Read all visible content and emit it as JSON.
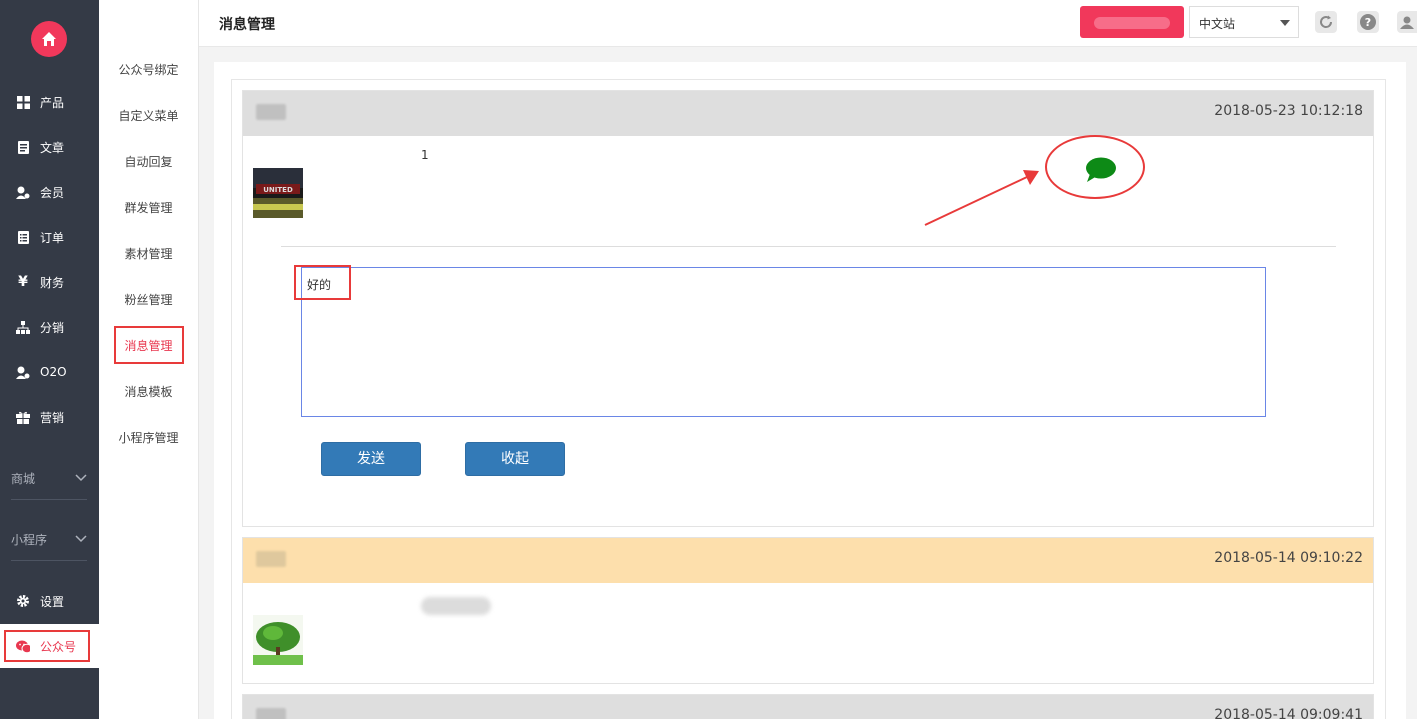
{
  "nav": {
    "items": [
      {
        "label": "产品",
        "icon": "grid-icon"
      },
      {
        "label": "文章",
        "icon": "document-icon"
      },
      {
        "label": "会员",
        "icon": "member-icon"
      },
      {
        "label": "订单",
        "icon": "order-icon"
      },
      {
        "label": "财务",
        "icon": "yen-icon"
      },
      {
        "label": "分销",
        "icon": "sitemap-icon"
      },
      {
        "label": "O2O",
        "icon": "o2o-icon"
      },
      {
        "label": "营销",
        "icon": "gift-icon"
      }
    ],
    "groups": [
      "商城",
      "小程序"
    ],
    "settings": "设置",
    "wechat": "公众号",
    "accent": "#f1385b"
  },
  "subnav": {
    "items": [
      "公众号绑定",
      "自定义菜单",
      "自动回复",
      "群发管理",
      "素材管理",
      "粉丝管理",
      "消息管理",
      "消息模板",
      "小程序管理"
    ],
    "active_index": 6
  },
  "header": {
    "title": "消息管理",
    "language": "中文站"
  },
  "messages": [
    {
      "time": "2018-05-23 10:12:18",
      "count": "1",
      "reply_text": "好的",
      "send_label": "发送",
      "collapse_label": "收起"
    },
    {
      "time": "2018-05-14 09:10:22"
    },
    {
      "time": "2018-05-14 09:09:41"
    }
  ]
}
